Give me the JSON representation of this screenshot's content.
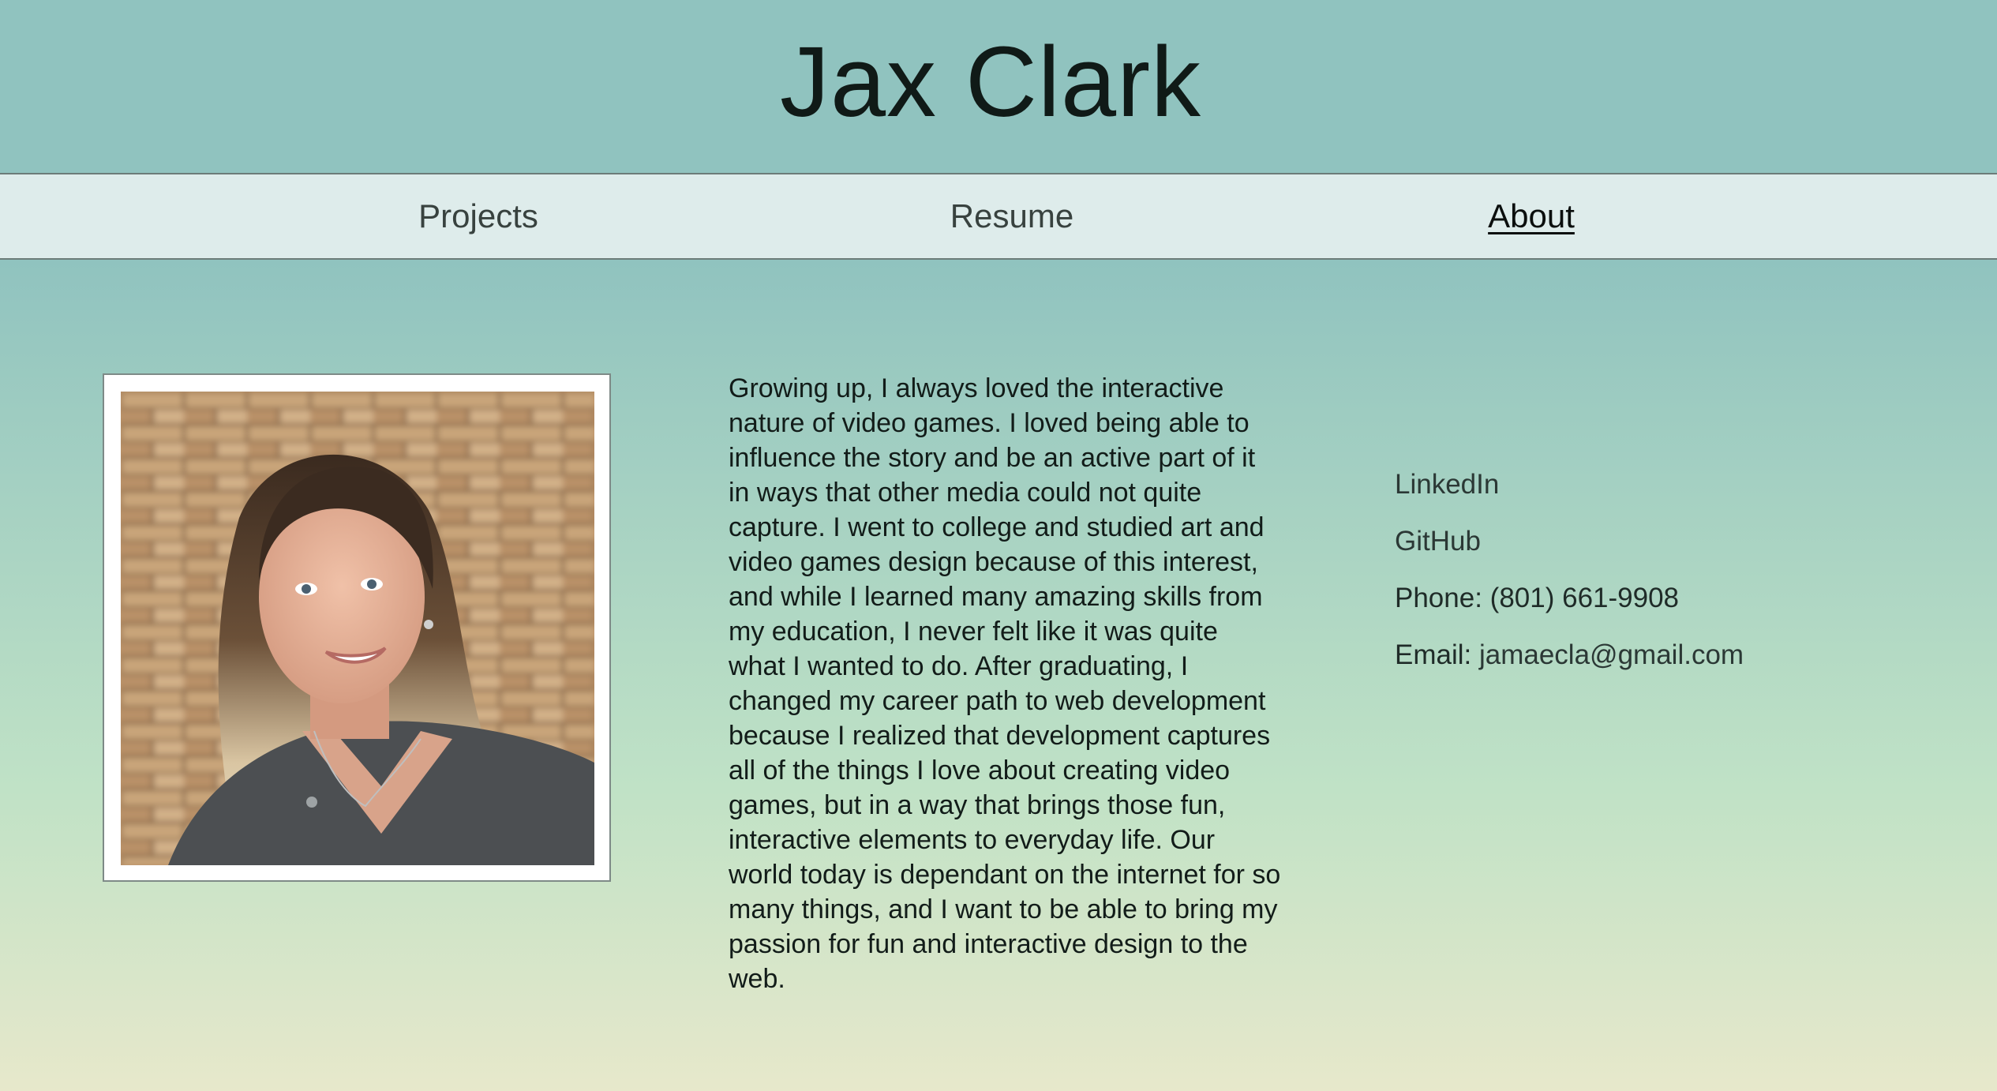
{
  "header": {
    "title": "Jax Clark"
  },
  "nav": {
    "items": [
      {
        "label": "Projects"
      },
      {
        "label": "Resume"
      },
      {
        "label": "About"
      }
    ],
    "active": "About"
  },
  "about": {
    "photo_description": "portrait",
    "bio": "Growing up, I always loved the interactive nature of video games. I loved being able to influence the story and be an active part of it in ways that other media could not quite capture. I went to college and studied art and video games design because of this interest, and while I learned many amazing skills from my education, I never felt like it was quite what I wanted to do. After graduating, I changed my career path to web development because I realized that development captures all of the things I love about creating video games, but in a way that brings those fun, interactive elements to everyday life. Our world today is dependant on the internet for so many things, and I want to be able to bring my passion for fun and interactive design to the web."
  },
  "contact": {
    "linkedin_label": "LinkedIn",
    "github_label": "GitHub",
    "phone_label": "Phone:",
    "phone_value": "(801) 661-9908",
    "email_label": "Email:",
    "email_value": "jamaecla@gmail.com"
  },
  "colors": {
    "background_top": "#90c3bf",
    "background_mid": "#c0e2c6",
    "background_bottom": "#e7e8cb",
    "nav_background": "#deeceb",
    "text_dark": "#101a17"
  }
}
